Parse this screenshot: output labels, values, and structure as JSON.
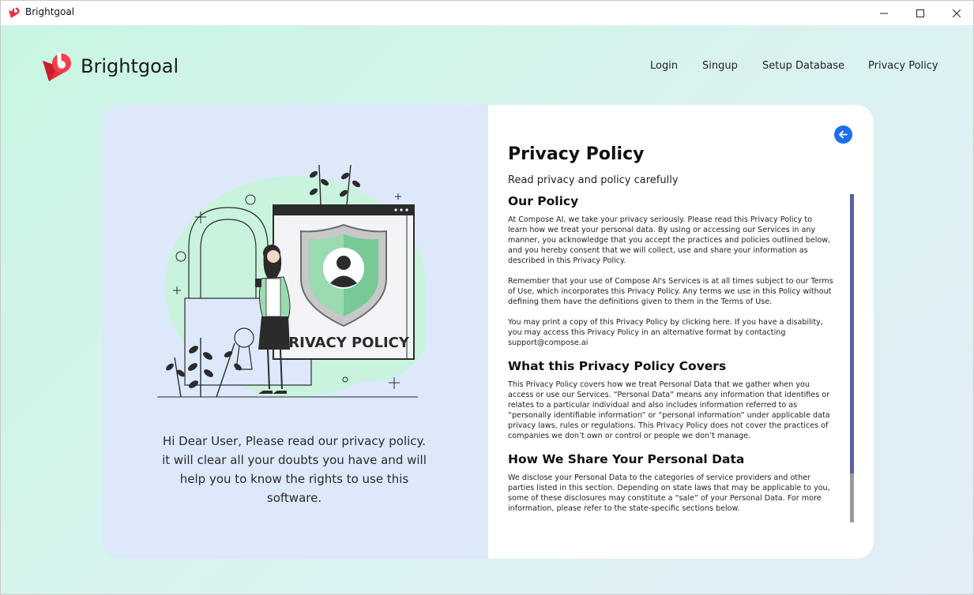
{
  "window": {
    "title": "Brightgoal",
    "controls": {
      "minimize": "—",
      "maximize": "☐",
      "close": "✕"
    }
  },
  "brand": {
    "name": "Brightgoal",
    "logo_icon": "brightgoal-logo-icon"
  },
  "nav": {
    "login": "Login",
    "signup": "Singup",
    "setup_database": "Setup Database",
    "privacy_policy": "Privacy Policy"
  },
  "left_panel": {
    "illustration_text": "PRIVACY POLICY",
    "message": "Hi Dear User, Please read our privacy policy. it will clear all your doubts you have and will help you to know the rights to use this software."
  },
  "right_panel": {
    "back_icon": "arrow-left-icon",
    "title": "Privacy Policy",
    "subtitle": "Read privacy and policy carefully",
    "sections": [
      {
        "heading": "Our Policy",
        "paragraphs": [
          "At Compose AI, we take your privacy seriously. Please read this Privacy Policy to learn how we treat your personal data. By using or accessing our Services in any manner, you acknowledge that you accept the practices and policies outlined below, and you hereby consent that we will collect, use and share your information as described in this Privacy Policy.",
          "Remember that your use of Compose AI's Services is at all times subject to our Terms of Use, which incorporates this Privacy Policy. Any terms we use in this Policy without defining them have the definitions given to them in the Terms of Use.",
          "You may print a copy of this Privacy Policy by clicking here. If you have a disability, you may access this Privacy Policy in an alternative format by contacting support@compose.ai"
        ]
      },
      {
        "heading": "What this Privacy Policy Covers",
        "paragraphs": [
          "This Privacy Policy covers how we treat Personal Data that we gather when you access or use our Services. “Personal Data” means any information that identifies or relates to a particular individual and also includes information referred to as “personally identifiable information” or “personal information” under applicable data privacy laws, rules or regulations. This Privacy Policy does not cover the practices of companies we don’t own or control or people we don’t manage."
        ]
      },
      {
        "heading": "How We Share Your Personal Data",
        "paragraphs": [
          "We disclose your Personal Data to the categories of service providers and other parties listed in this section. Depending on state laws that may be applicable to you, some of these disclosures may constitute a “sale” of your Personal Data. For more information, please refer to the state-specific sections below."
        ]
      }
    ]
  },
  "colors": {
    "accent_blue": "#1a6ff0",
    "brand_red": "#e8303a",
    "scrollbar_thumb": "#5b5fa3",
    "left_panel_bg": "#dde9fb"
  }
}
